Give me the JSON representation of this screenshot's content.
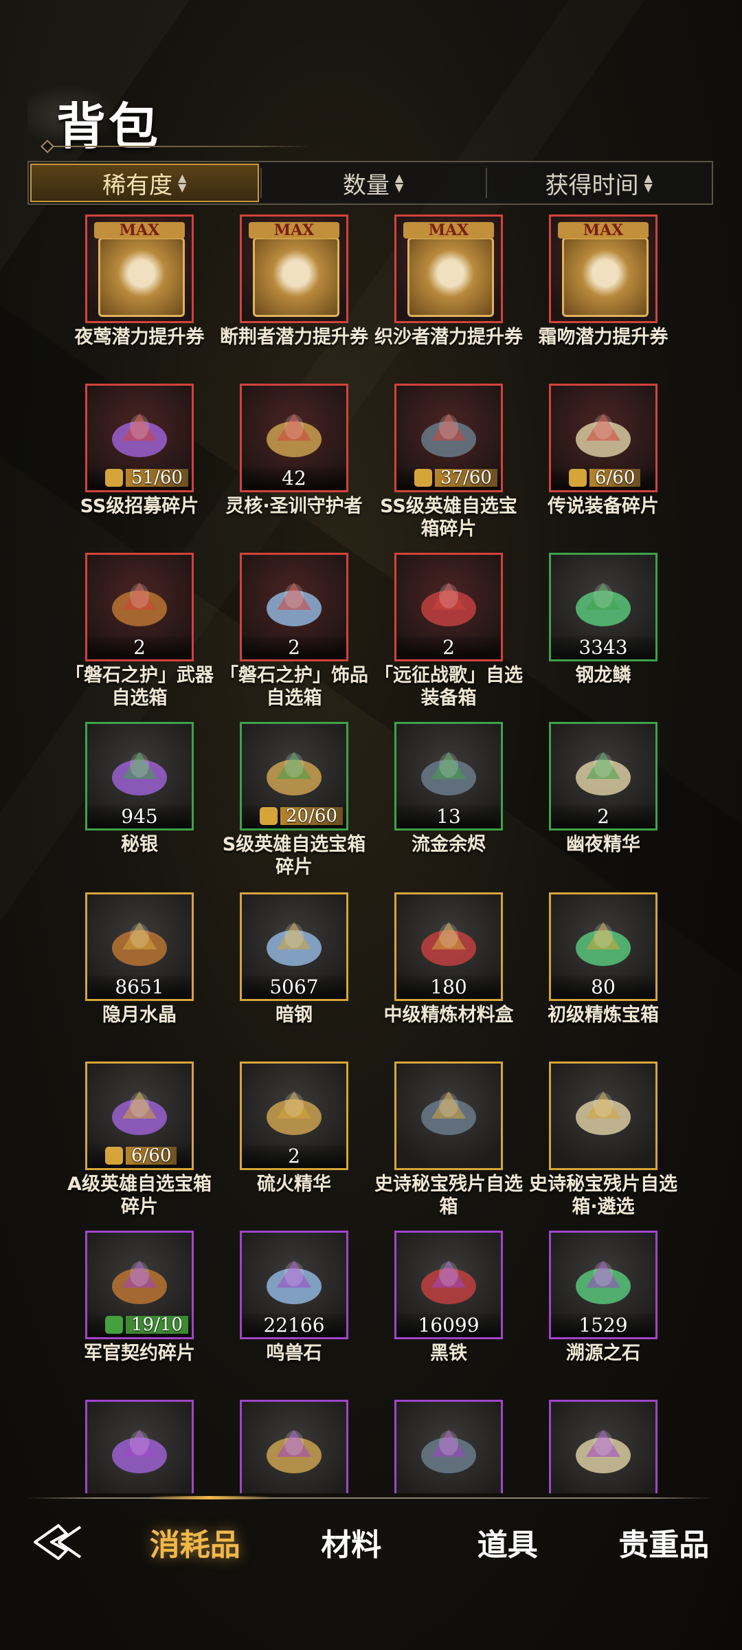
{
  "title": "背包",
  "sort": {
    "options": [
      {
        "label": "稀有度",
        "active": true
      },
      {
        "label": "数量",
        "active": false
      },
      {
        "label": "获得时间",
        "active": false
      }
    ]
  },
  "items": [
    {
      "name": "夜莺潜力提升券",
      "rarity": "red",
      "badge": "MAX",
      "count": "",
      "fragment": ""
    },
    {
      "name": "断荆者潜力提升券",
      "rarity": "red",
      "badge": "MAX",
      "count": "",
      "fragment": ""
    },
    {
      "name": "织沙者潜力提升券",
      "rarity": "red",
      "badge": "MAX",
      "count": "",
      "fragment": ""
    },
    {
      "name": "霜吻潜力提升券",
      "rarity": "red",
      "badge": "MAX",
      "count": "",
      "fragment": ""
    },
    {
      "name": "SS级招募碎片",
      "rarity": "red",
      "badge": "",
      "count": "",
      "fragment": "51/60"
    },
    {
      "name": "灵核·圣训守护者",
      "rarity": "red",
      "badge": "",
      "count": "42",
      "fragment": ""
    },
    {
      "name": "SS级英雄自选宝箱碎片",
      "rarity": "red",
      "badge": "",
      "count": "",
      "fragment": "37/60"
    },
    {
      "name": "传说装备碎片",
      "rarity": "red",
      "badge": "",
      "count": "",
      "fragment": "6/60"
    },
    {
      "name": "「磐石之护」武器自选箱",
      "rarity": "red",
      "badge": "",
      "count": "2",
      "fragment": ""
    },
    {
      "name": "「磐石之护」饰品自选箱",
      "rarity": "red",
      "badge": "",
      "count": "2",
      "fragment": ""
    },
    {
      "name": "「远征战歌」自选装备箱",
      "rarity": "red",
      "badge": "",
      "count": "2",
      "fragment": ""
    },
    {
      "name": "钢龙鳞",
      "rarity": "green",
      "badge": "",
      "count": "3343",
      "fragment": ""
    },
    {
      "name": "秘银",
      "rarity": "green",
      "badge": "",
      "count": "945",
      "fragment": ""
    },
    {
      "name": "S级英雄自选宝箱碎片",
      "rarity": "green",
      "badge": "",
      "count": "",
      "fragment": "20/60"
    },
    {
      "name": "流金余烬",
      "rarity": "green",
      "badge": "",
      "count": "13",
      "fragment": ""
    },
    {
      "name": "幽夜精华",
      "rarity": "green",
      "badge": "",
      "count": "2",
      "fragment": ""
    },
    {
      "name": "隐月水晶",
      "rarity": "gold",
      "badge": "",
      "count": "8651",
      "fragment": ""
    },
    {
      "name": "暗钢",
      "rarity": "gold",
      "badge": "",
      "count": "5067",
      "fragment": ""
    },
    {
      "name": "中级精炼材料盒",
      "rarity": "gold",
      "badge": "",
      "count": "180",
      "fragment": ""
    },
    {
      "name": "初级精炼宝箱",
      "rarity": "gold",
      "badge": "",
      "count": "80",
      "fragment": ""
    },
    {
      "name": "A级英雄自选宝箱碎片",
      "rarity": "gold",
      "badge": "",
      "count": "",
      "fragment": "6/60"
    },
    {
      "name": "硫火精华",
      "rarity": "gold",
      "badge": "",
      "count": "2",
      "fragment": ""
    },
    {
      "name": "史诗秘宝残片自选箱",
      "rarity": "gold",
      "badge": "",
      "count": "",
      "fragment": ""
    },
    {
      "name": "史诗秘宝残片自选箱·遴选",
      "rarity": "gold",
      "badge": "",
      "count": "",
      "fragment": ""
    },
    {
      "name": "军官契约碎片",
      "rarity": "purple",
      "badge": "",
      "count": "",
      "fragment": "19/10"
    },
    {
      "name": "鸣兽石",
      "rarity": "purple",
      "badge": "",
      "count": "22166",
      "fragment": ""
    },
    {
      "name": "黑铁",
      "rarity": "purple",
      "badge": "",
      "count": "16099",
      "fragment": ""
    },
    {
      "name": "溯源之石",
      "rarity": "purple",
      "badge": "",
      "count": "1529",
      "fragment": ""
    },
    {
      "name": "",
      "rarity": "purple",
      "badge": "",
      "count": "",
      "fragment": ""
    },
    {
      "name": "",
      "rarity": "purple",
      "badge": "",
      "count": "",
      "fragment": ""
    },
    {
      "name": "",
      "rarity": "purple",
      "badge": "",
      "count": "",
      "fragment": ""
    },
    {
      "name": "",
      "rarity": "purple",
      "badge": "",
      "count": "",
      "fragment": ""
    }
  ],
  "nav": {
    "back_icon": "back-arrow-icon",
    "tabs": [
      {
        "label": "消耗品",
        "active": true
      },
      {
        "label": "材料",
        "active": false
      },
      {
        "label": "道具",
        "active": false
      },
      {
        "label": "贵重品",
        "active": false
      }
    ]
  },
  "colors": {
    "red": "#d2433b",
    "green": "#3fa24a",
    "gold": "#d6a53a",
    "purple": "#a145c9",
    "accent": "#f1b84a"
  }
}
